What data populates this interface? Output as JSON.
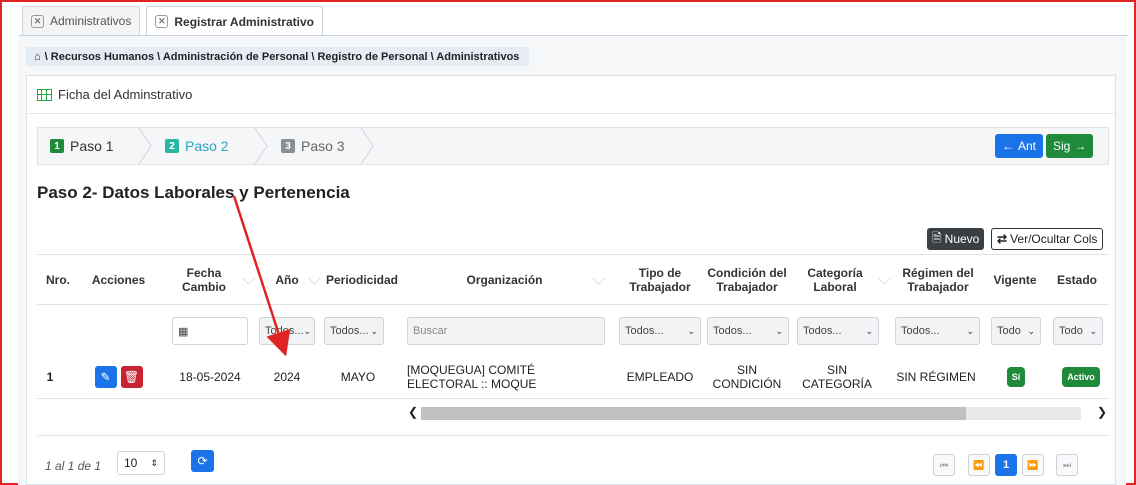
{
  "tabs": [
    {
      "label": "Administrativos",
      "active": false
    },
    {
      "label": "Registrar Administrativo",
      "active": true
    }
  ],
  "breadcrumb": "\\ Recursos Humanos \\ Administración de Personal \\ Registro de Personal \\ Administrativos",
  "card": {
    "title": "Ficha del Adminstrativo"
  },
  "steps": [
    {
      "num": "1",
      "label": "Paso 1",
      "color": "#1f8a3a"
    },
    {
      "num": "2",
      "label": "Paso 2",
      "color": "#2bb5a0"
    },
    {
      "num": "3",
      "label": "Paso 3",
      "color": "#8a8f94"
    }
  ],
  "nav": {
    "prev": "Ant",
    "next": "Sig"
  },
  "section_title": "Paso 2- Datos Laborales y Pertenencia",
  "toolbar": {
    "new_label": "Nuevo",
    "cols_label": "Ver/Ocultar Cols"
  },
  "columns": {
    "nro": "Nro.",
    "acciones": "Acciones",
    "fecha": "Fecha Cambio",
    "anio": "Año",
    "periodicidad": "Periodicidad",
    "organizacion": "Organización",
    "tipo": "Tipo de Trabajador",
    "condicion": "Condición del Trabajador",
    "categoria": "Categoría Laboral",
    "regimen": "Régimen del Trabajador",
    "vigente": "Vigente",
    "estado": "Estado"
  },
  "filters": {
    "anio": "Todos...",
    "periodicidad": "Todos...",
    "organizacion_placeholder": "Buscar",
    "tipo": "Todos...",
    "condicion": "Todos...",
    "categoria": "Todos...",
    "regimen": "Todos...",
    "vigente": "Todo",
    "estado": "Todo"
  },
  "rows": [
    {
      "nro": "1",
      "fecha": "18-05-2024",
      "anio": "2024",
      "periodicidad": "MAYO",
      "organizacion": "[MOQUEGUA] COMITÉ ELECTORAL :: MOQUE",
      "tipo": "EMPLEADO",
      "condicion": "SIN CONDICIÓN",
      "categoria": "SIN CATEGORÍA",
      "regimen": "SIN RÉGIMEN",
      "vigente": "Sí",
      "estado": "Activo"
    }
  ],
  "pager": {
    "info": "1 al 1 de 1",
    "page_size": "10",
    "current_page": "1"
  },
  "colors": {
    "primary": "#1a73e8",
    "success": "#1f8a3a",
    "danger": "#c82333",
    "annotation": "#e02424"
  }
}
